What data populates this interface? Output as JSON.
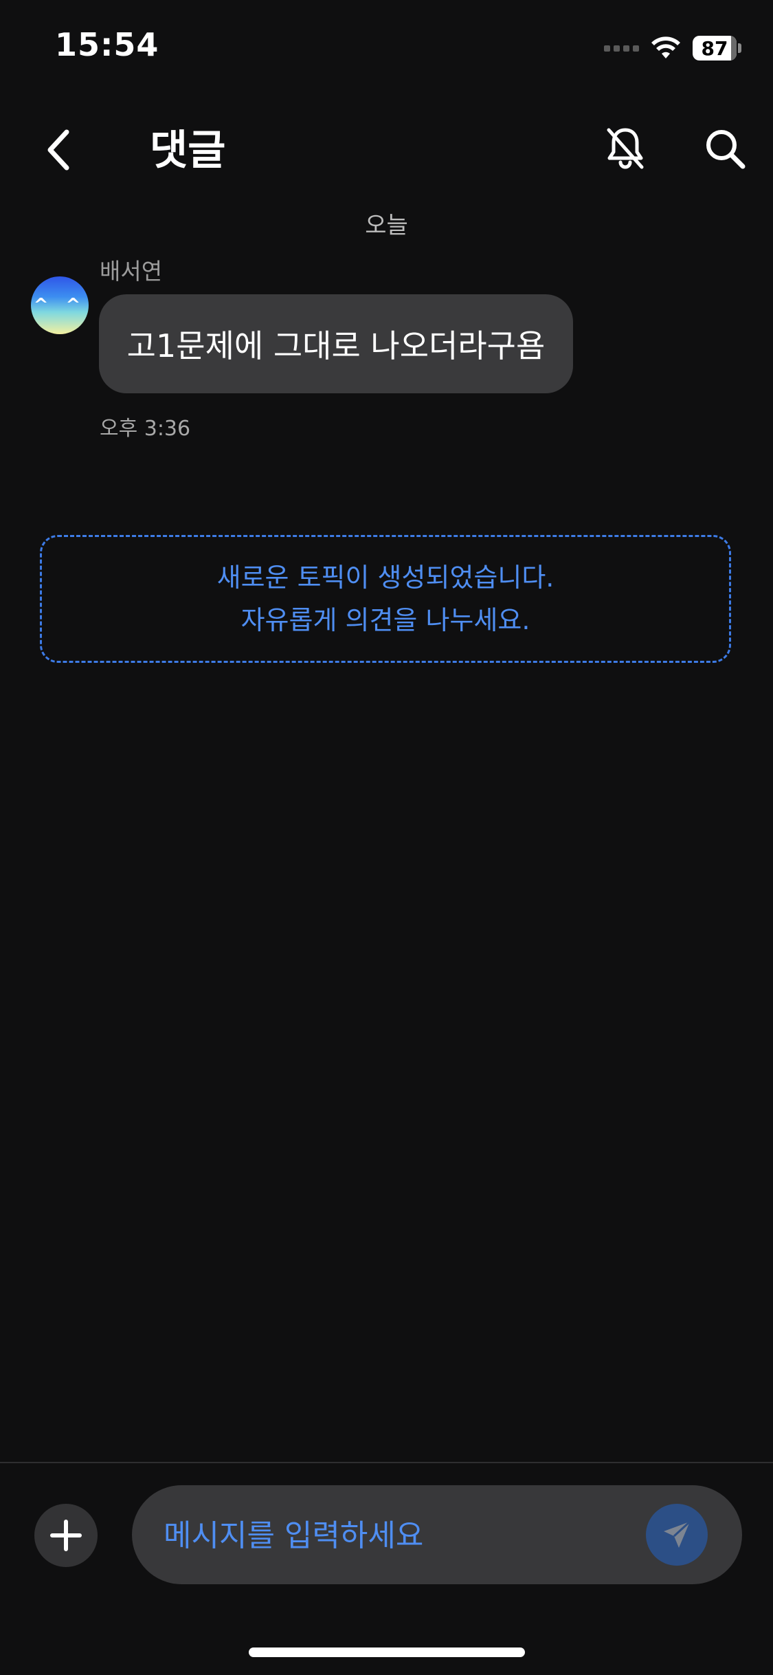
{
  "status_bar": {
    "time": "15:54",
    "battery": "87"
  },
  "header": {
    "title": "댓글",
    "back_icon": "chevron-left-icon",
    "mute_icon": "bell-slash-icon",
    "search_icon": "search-icon"
  },
  "chat": {
    "date_separator": "오늘",
    "messages": [
      {
        "sender": "배서연",
        "avatar_face": "^ ^",
        "text": "고1문제에 그대로 나오더라구욤",
        "time": "오후 3:36"
      }
    ],
    "topic_notice": {
      "line1": "새로운 토픽이 생성되었습니다.",
      "line2": "자유롭게 의견을 나누세요."
    }
  },
  "composer": {
    "placeholder": "메시지를 입력하세요",
    "add_icon": "plus-icon",
    "send_icon": "send-icon"
  },
  "colors": {
    "background": "#0f0f10",
    "bubble": "#3a3a3c",
    "accent": "#4f8ef2",
    "send_button": "#2c4f86"
  }
}
